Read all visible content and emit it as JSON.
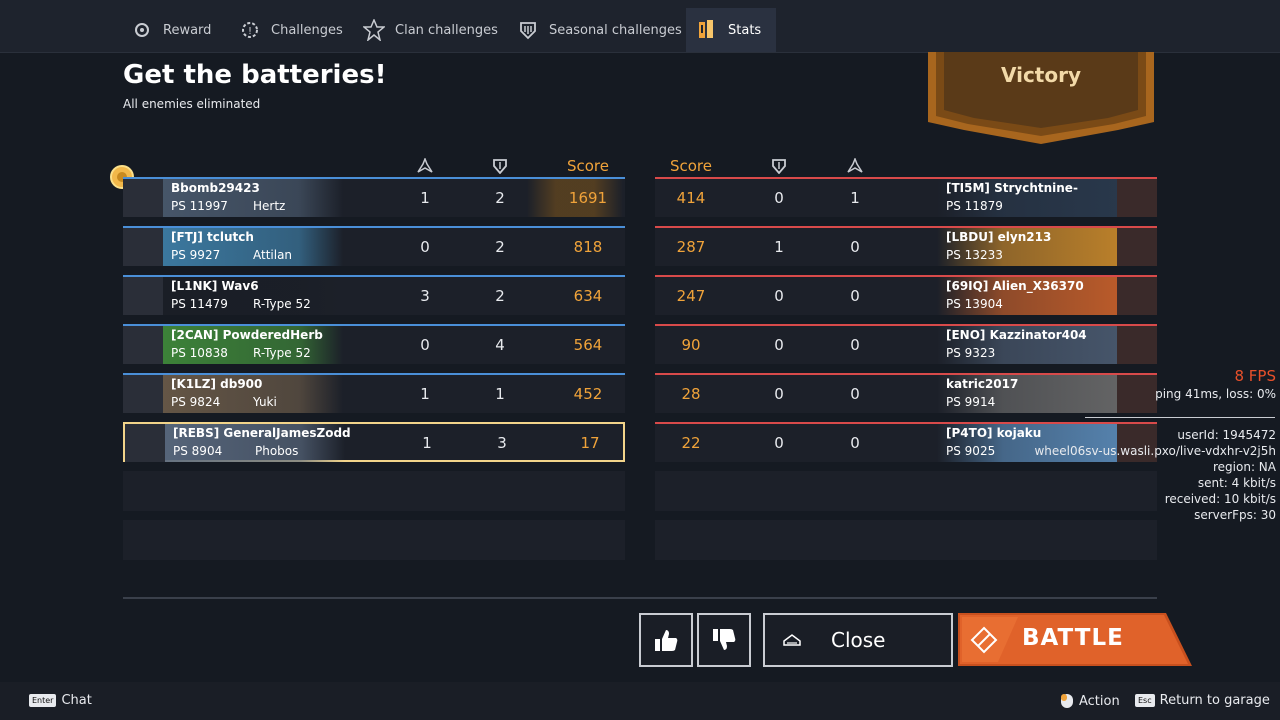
{
  "tabs": [
    {
      "label": "Reward",
      "icon": "reward-icon",
      "active": false
    },
    {
      "label": "Challenges",
      "icon": "challenges-icon",
      "active": false
    },
    {
      "label": "Clan challenges",
      "icon": "clan-challenges-icon",
      "active": false
    },
    {
      "label": "Seasonal challenges",
      "icon": "seasonal-challenges-icon",
      "active": false
    },
    {
      "label": "Stats",
      "icon": "stats-icon",
      "active": true
    }
  ],
  "match": {
    "title": "Get the batteries!",
    "subtitle": "All enemies eliminated",
    "result": "Victory"
  },
  "columns": {
    "score_label": "Score",
    "kills_icon": "kills-icon",
    "shield_icon": "shield-icon"
  },
  "team_left": [
    {
      "name": "Bbomb29423",
      "ps": "PS 11997",
      "robot": "Hertz",
      "kills": "1",
      "assists": "2",
      "score": "1691",
      "mvp": true,
      "me": false,
      "card_color": "#4a5a6e"
    },
    {
      "name": "[FTJ] tclutch",
      "ps": "PS 9927",
      "robot": "Attilan",
      "kills": "0",
      "assists": "2",
      "score": "818",
      "mvp": false,
      "me": false,
      "card_color": "#3e7fa8"
    },
    {
      "name": "[L1NK] Wav6",
      "ps": "PS 11479",
      "robot": "R-Type 52",
      "kills": "3",
      "assists": "2",
      "score": "634",
      "mvp": false,
      "me": false,
      "card_color": "#1a1e26"
    },
    {
      "name": "[2CAN] PowderedHerb",
      "ps": "PS 10838",
      "robot": "R-Type 52",
      "kills": "0",
      "assists": "4",
      "score": "564",
      "mvp": false,
      "me": false,
      "card_color": "#3f8a3a"
    },
    {
      "name": "[K1LZ] db900",
      "ps": "PS 9824",
      "robot": "Yuki",
      "kills": "1",
      "assists": "1",
      "score": "452",
      "mvp": false,
      "me": false,
      "card_color": "#6a5a48"
    },
    {
      "name": "[REBS] GeneralJamesZodd",
      "ps": "PS 8904",
      "robot": "Phobos",
      "kills": "1",
      "assists": "3",
      "score": "17",
      "mvp": false,
      "me": true,
      "card_color": "#5a6a80"
    }
  ],
  "team_right": [
    {
      "name": "[TI5M] Strychtnine-",
      "ps": "PS 11879",
      "kills": "1",
      "assists": "0",
      "score": "414",
      "card_color": "#2a3a4e"
    },
    {
      "name": "[LBDU] elyn213",
      "ps": "PS 13233",
      "kills": "0",
      "assists": "1",
      "score": "287",
      "card_color": "#c8882a"
    },
    {
      "name": "[69IQ] Alien_X36370",
      "ps": "PS 13904",
      "kills": "0",
      "assists": "0",
      "score": "247",
      "card_color": "#c8602a"
    },
    {
      "name": "[ENO] Kazzinator404",
      "ps": "PS 9323",
      "kills": "0",
      "assists": "0",
      "score": "90",
      "card_color": "#4a5a70"
    },
    {
      "name": "katric2017",
      "ps": "PS 9914",
      "kills": "0",
      "assists": "0",
      "score": "28",
      "card_color": "#6a6a6a"
    },
    {
      "name": "[P4TO] kojaku",
      "ps": "PS 9025",
      "kills": "0",
      "assists": "0",
      "score": "22",
      "card_color": "#5a8ab8"
    }
  ],
  "buttons": {
    "like_icon": "thumbs-up-icon",
    "dislike_icon": "thumbs-down-icon",
    "close_label": "Close",
    "battle_label": "BATTLE"
  },
  "debug": {
    "fps": "8 FPS",
    "ping": "ping 41ms, loss:  0%",
    "user_id": "userId: 1945472",
    "server": "wheel06sv-us.wasli.pxo/live-vdxhr-v2j5h",
    "region": "region: NA",
    "sent": "sent: 4 kbit/s",
    "received": "received: 10 kbit/s",
    "server_fps": "serverFps: 30"
  },
  "footer": {
    "chat_key": "Enter",
    "chat_label": "Chat",
    "action_label": "Action",
    "garage_key": "Esc",
    "garage_label": "Return to garage"
  },
  "colors": {
    "accent": "#f0a33a",
    "blue_team": "#4a8fd8",
    "red_team": "#d84a4a",
    "battle": "#e0622a"
  }
}
